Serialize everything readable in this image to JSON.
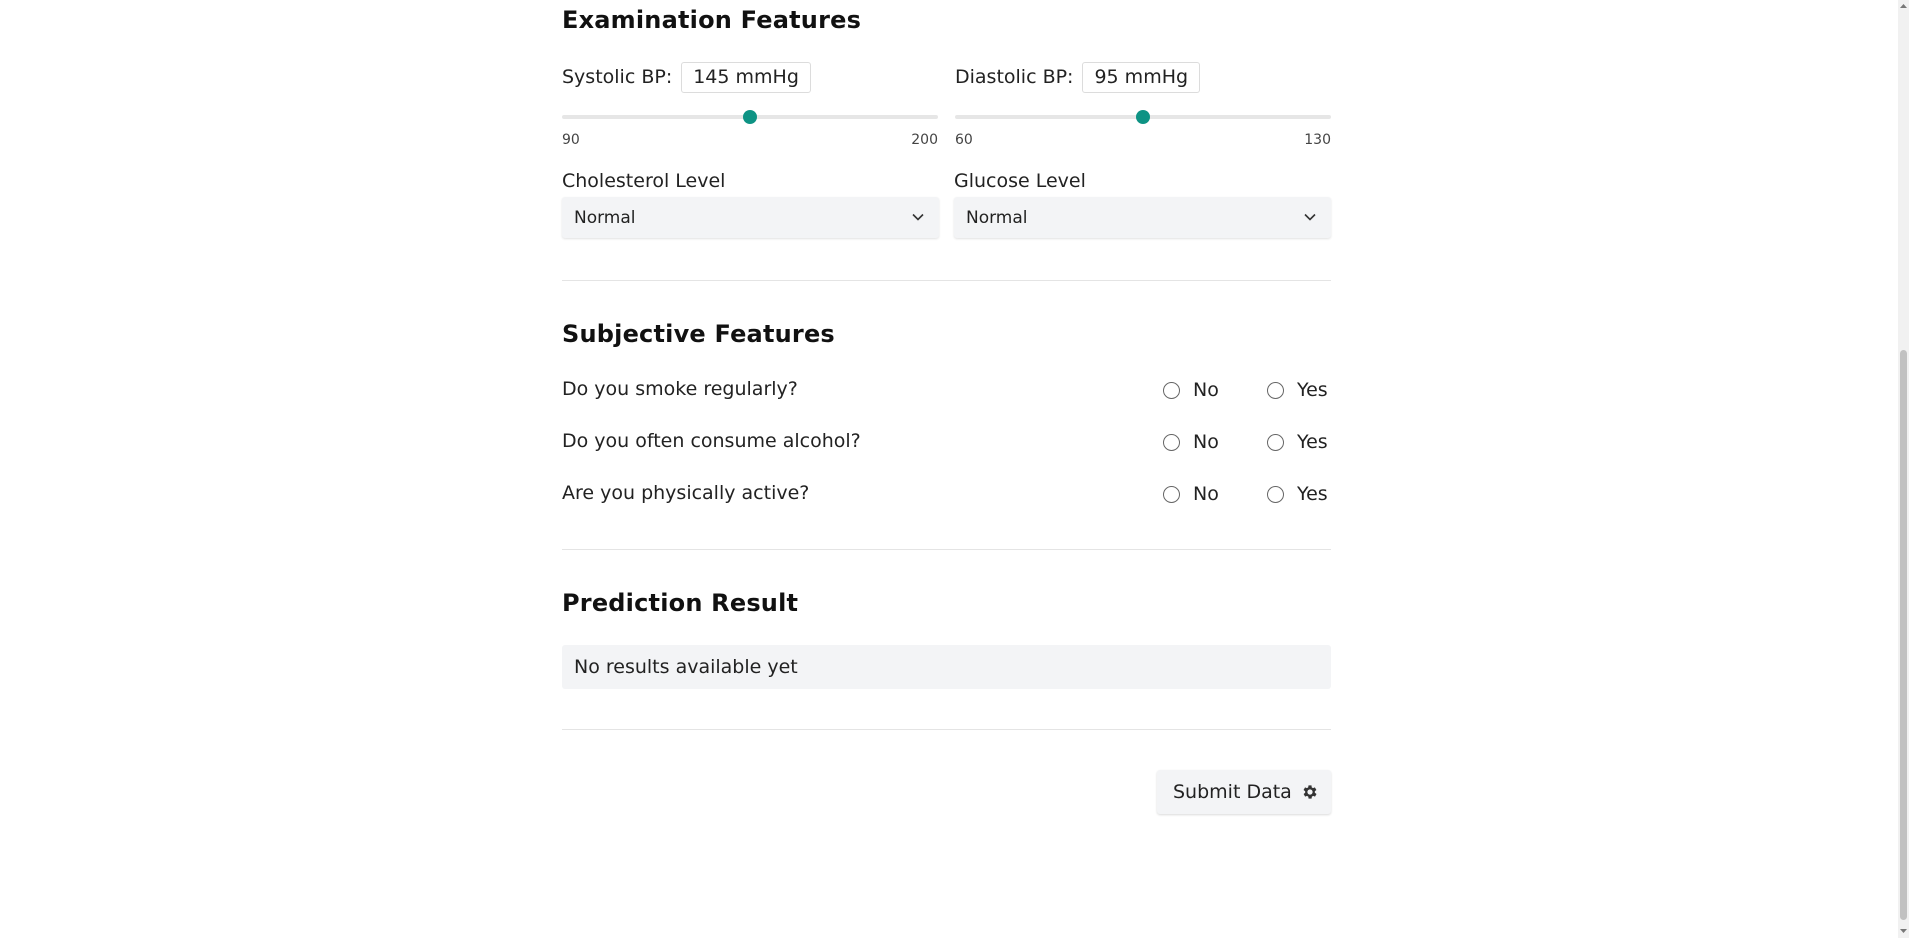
{
  "examination": {
    "title": "Examination Features",
    "systolic": {
      "label": "Systolic BP:",
      "value_text": "145 mmHg",
      "value": 145,
      "min": 90,
      "max": 200,
      "min_label": "90",
      "max_label": "200"
    },
    "diastolic": {
      "label": "Diastolic BP:",
      "value_text": "95 mmHg",
      "value": 95,
      "min": 60,
      "max": 130,
      "min_label": "60",
      "max_label": "130"
    },
    "cholesterol": {
      "label": "Cholesterol Level",
      "selected": "Normal"
    },
    "glucose": {
      "label": "Glucose Level",
      "selected": "Normal"
    }
  },
  "subjective": {
    "title": "Subjective Features",
    "questions": [
      {
        "text": "Do you smoke regularly?",
        "no": "No",
        "yes": "Yes"
      },
      {
        "text": "Do you often consume alcohol?",
        "no": "No",
        "yes": "Yes"
      },
      {
        "text": "Are you physically active?",
        "no": "No",
        "yes": "Yes"
      }
    ]
  },
  "prediction": {
    "title": "Prediction Result",
    "result_text": "No results available yet"
  },
  "actions": {
    "submit_label": "Submit Data",
    "submit_icon": "gear-icon"
  },
  "colors": {
    "accent": "#0e9384",
    "panel_bg": "#f3f4f6"
  }
}
